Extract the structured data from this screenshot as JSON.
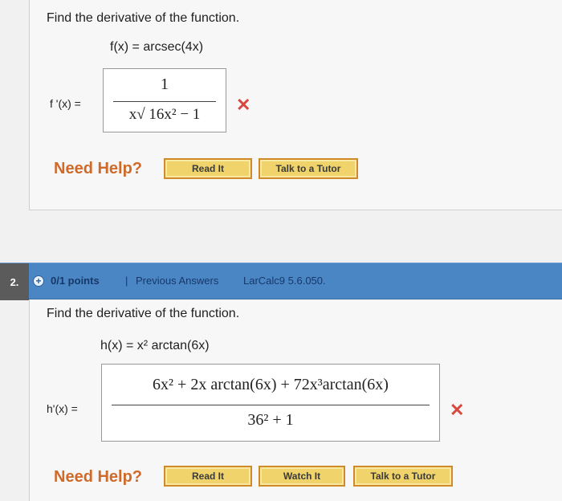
{
  "problem1": {
    "question": "Find the derivative of the function.",
    "function_def": "f(x) = arcsec(4x)",
    "answer_label": "f '(x) =",
    "answer_numerator": "1",
    "answer_denominator": "x√ 16x² − 1",
    "result_mark": "✕",
    "need_help": "Need Help?",
    "buttons": [
      "Read It",
      "Talk to a Tutor"
    ]
  },
  "problem2": {
    "number": "2.",
    "points": "0/1 points",
    "separator": "|",
    "previous_answers": "Previous Answers",
    "source": "LarCalc9 5.6.050.",
    "question": "Find the derivative of the function.",
    "function_def": "h(x) = x² arctan(6x)",
    "answer_label": "h'(x) =",
    "answer_numerator": "6x² + 2x arctan(6x) + 72x³arctan(6x)",
    "answer_denominator": "36² + 1",
    "result_mark": "✕",
    "need_help": "Need Help?",
    "buttons": [
      "Read It",
      "Watch It",
      "Talk to a Tutor"
    ]
  },
  "colors": {
    "header_bar": "#4b86c4",
    "need_help": "#cf6a2a",
    "wrong_mark": "#d8473d",
    "button_fill": "#f0d36a"
  },
  "icons": {
    "expand": "plus-circle-icon",
    "wrong": "x-mark-icon"
  }
}
